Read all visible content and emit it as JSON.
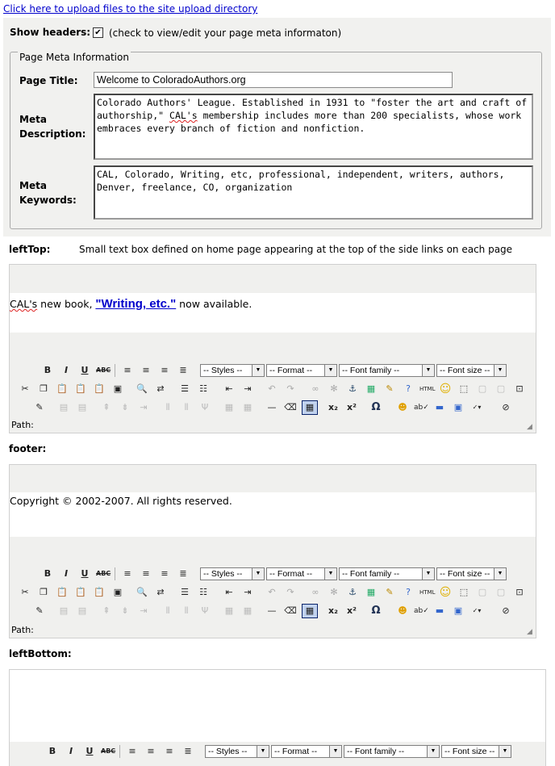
{
  "upload_link": "Click here to upload files to the site upload directory",
  "show_headers": {
    "label": "Show headers:",
    "checked_glyph": "✔",
    "hint": "(check to view/edit your page meta informaton)"
  },
  "meta": {
    "legend": "Page Meta Information",
    "title_label": "Page Title:",
    "title_value": "Welcome to ColoradoAuthors.org",
    "desc_label_1": "Meta",
    "desc_label_2": "Description:",
    "desc_pre": "Colorado Authors' League. Established in 1931 to \"foster the art and craft of authorship,\" ",
    "desc_cal": "CAL's",
    "desc_post": " membership includes more than 200 specialists, whose work embraces every branch of fiction and nonfiction.",
    "kw_label_1": "Meta",
    "kw_label_2": "Keywords:",
    "kw_value": "CAL, Colorado, Writing, etc, professional, independent, writers, authors, Denver, freelance, CO, organization"
  },
  "lefttop": {
    "label": "leftTop:",
    "desc": "Small text box defined on home page appearing at the top of the side links on each page",
    "content_cal": "CAL's",
    "content_mid": " new book, ",
    "content_link": "\"Writing, etc.\"",
    "content_end": " now available."
  },
  "footer": {
    "label": "footer:",
    "content": "Copyright © 2002-2007. All rights reserved."
  },
  "leftbottom": {
    "label": "leftBottom:"
  },
  "toolbar": {
    "styles": "-- Styles --",
    "format": "-- Format --",
    "font_family": "-- Font family --",
    "font_size": "-- Font size --",
    "path_label": "Path:",
    "bold": "B",
    "italic": "I",
    "underline": "U",
    "strike": "ABC",
    "html": "HTML",
    "omega": "Ω",
    "sub": "x₂",
    "sup": "x²"
  },
  "colors": {
    "link": "#0000cc",
    "panel": "#f1f1ef",
    "toolbar": "#f0f0ee"
  }
}
